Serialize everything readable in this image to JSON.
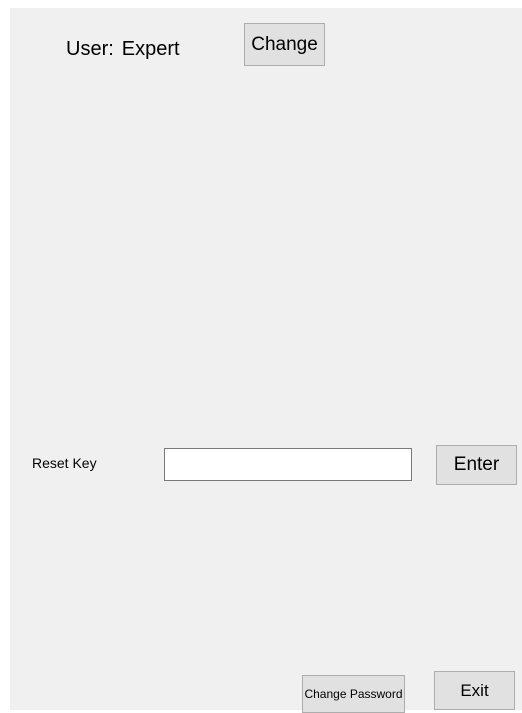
{
  "header": {
    "user_prefix": "User:",
    "user_name": "Expert",
    "change_label": "Change"
  },
  "reset": {
    "label": "Reset Key",
    "input_value": "",
    "enter_label": "Enter"
  },
  "footer": {
    "change_password_label": "Change Password",
    "exit_label": "Exit"
  }
}
